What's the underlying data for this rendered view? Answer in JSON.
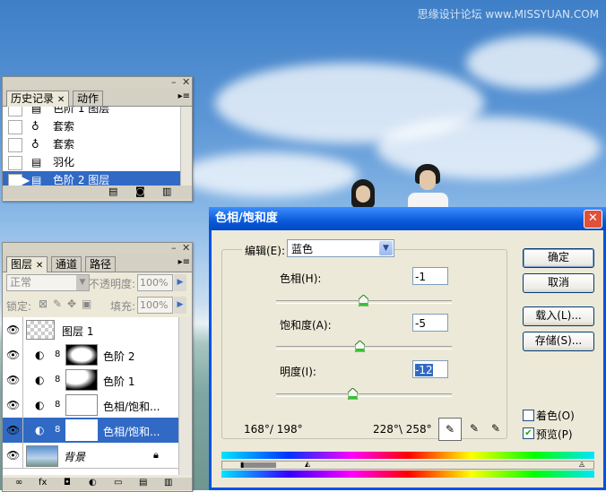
{
  "watermark": "思缘设计论坛 www.MISSYUAN.COM",
  "history_panel": {
    "tabs": [
      "历史记录",
      "动作"
    ],
    "items": [
      {
        "label": "色阶 1 图层",
        "icon": "levels-icon"
      },
      {
        "label": "套索",
        "icon": "lasso-icon"
      },
      {
        "label": "套索",
        "icon": "lasso-icon"
      },
      {
        "label": "羽化",
        "icon": "feather-icon"
      },
      {
        "label": "色阶 2 图层",
        "icon": "levels-icon",
        "selected": true
      }
    ]
  },
  "layers_panel": {
    "tabs": [
      "图层",
      "通道",
      "路径"
    ],
    "blend_mode": "正常",
    "opacity_label": "不透明度:",
    "opacity_value": "100%",
    "lock_label": "锁定:",
    "fill_label": "填充:",
    "fill_value": "100%",
    "layers": [
      {
        "name": "图层 1",
        "type": "pixel"
      },
      {
        "name": "色阶 2",
        "type": "adjustment"
      },
      {
        "name": "色阶 1",
        "type": "adjustment"
      },
      {
        "name": "色相/饱和...",
        "type": "adjustment"
      },
      {
        "name": "色相/饱和...",
        "type": "adjustment",
        "selected": true
      },
      {
        "name": "背景",
        "type": "background",
        "locked": true
      }
    ]
  },
  "dialog": {
    "title": "色相/饱和度",
    "edit_label": "编辑(E):",
    "edit_value": "蓝色",
    "hue_label": "色相(H):",
    "hue_value": "-1",
    "saturation_label": "饱和度(A):",
    "saturation_value": "-5",
    "lightness_label": "明度(I):",
    "lightness_value": "-12",
    "range_left": "168°/ 198°",
    "range_right": "228°\\ 258°",
    "buttons": {
      "ok": "确定",
      "cancel": "取消",
      "load": "载入(L)...",
      "save": "存储(S)..."
    },
    "colorize_label": "着色(O)",
    "colorize_checked": false,
    "preview_label": "预览(P)",
    "preview_checked": true,
    "accent_color": "#0054e3"
  }
}
